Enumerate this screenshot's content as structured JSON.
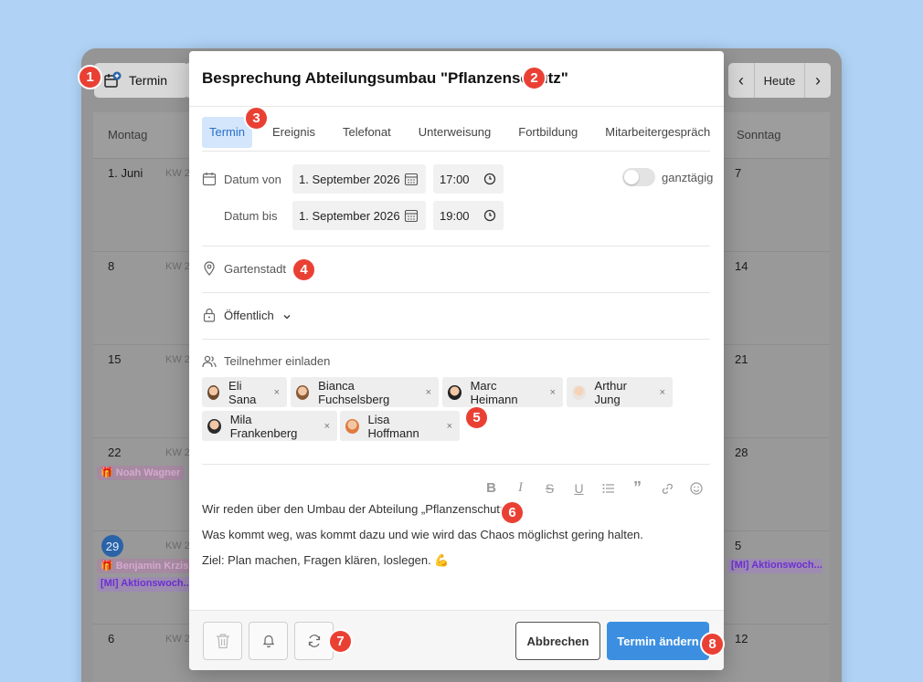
{
  "calendar": {
    "new_button_label": "Termin",
    "nav": {
      "prev_icon": "chevron-left-icon",
      "today_label": "Heute",
      "next_icon": "chevron-right-icon"
    },
    "day_headers": {
      "monday": "Montag",
      "sunday": "Sonntag"
    },
    "left_column": [
      {
        "day": "1. Juni",
        "kw": "KW 2"
      },
      {
        "day": "8",
        "kw": "KW 2"
      },
      {
        "day": "15",
        "kw": "KW 2"
      },
      {
        "day": "22",
        "kw": "KW 2"
      },
      {
        "day": "29",
        "kw": "KW 2"
      },
      {
        "day": "6",
        "kw": "KW 2"
      }
    ],
    "right_column": [
      "7",
      "14",
      "21",
      "28",
      "5",
      "12"
    ],
    "events": {
      "noah": "🎁 Noah Wagner",
      "benjamin": "🎁 Benjamin Krzis",
      "aktion_left": "[MI] Aktionswoch...",
      "aktion_right": "[MI] Aktionswoch..."
    }
  },
  "modal": {
    "title": "Besprechung Abteilungsumbau \"Pflanzenschutz\"",
    "tabs": [
      "Termin",
      "Ereignis",
      "Telefonat",
      "Unterweisung",
      "Fortbildung",
      "Mitarbeitergespräch"
    ],
    "date_from_label": "Datum von",
    "date_from": "1. September 2026",
    "time_from": "17:00",
    "date_to_label": "Datum bis",
    "date_to": "1. September 2026",
    "time_to": "19:00",
    "allday_label": "ganztägig",
    "location": "Gartenstadt",
    "visibility": "Öffentlich",
    "invite_label": "Teilnehmer einladen",
    "participants": [
      "Eli Sana",
      "Bianca Fuchselsberg",
      "Marc Heimann",
      "Arthur Jung",
      "Mila Frankenberg",
      "Lisa Hoffmann"
    ],
    "remove_glyph": "×",
    "editor_tools": [
      "B",
      "I",
      "S",
      "U",
      "list",
      "quote",
      "link",
      "emoji"
    ],
    "description": [
      "Wir reden über den Umbau der Abteilung „Pflanzenschutz“",
      "Was kommt weg, was kommt dazu und wie wird das Chaos möglichst gering halten.",
      "Ziel: Plan machen, Fragen klären, loslegen. 💪"
    ],
    "cancel_label": "Abbrechen",
    "submit_label": "Termin ändern"
  },
  "markers": [
    "1",
    "2",
    "3",
    "4",
    "5",
    "6",
    "7",
    "8"
  ],
  "colors": {
    "accent": "#3c8fe0",
    "tab_active_bg": "#d3e6fb",
    "marker": "#ea4034",
    "today_badge": "#2a63a8"
  }
}
